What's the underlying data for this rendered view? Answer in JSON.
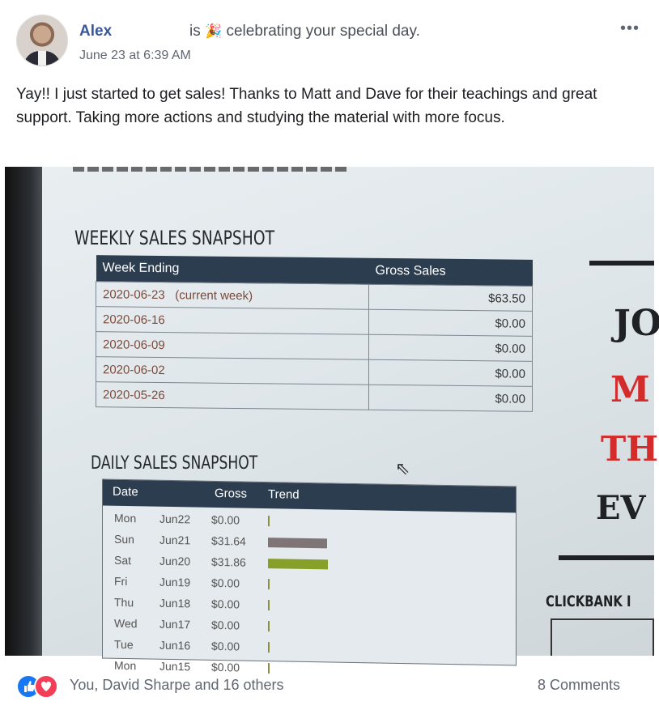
{
  "post": {
    "author": "Alex",
    "activity_prefix": "is",
    "activity_text": "celebrating your special day.",
    "timestamp": "June 23 at 6:39 AM",
    "more_icon": "•••",
    "text": "Yay!! I just started to get sales! Thanks to Matt and Dave for their teachings and great support. Taking more actions and studying the material with more focus."
  },
  "photo": {
    "weekly_title": "WEEKLY SALES SNAPSHOT",
    "weekly_headers": [
      "Week Ending",
      "Gross Sales"
    ],
    "weekly_rows": [
      {
        "date": "2020-06-23",
        "note": "(current week)",
        "amount": "$63.50"
      },
      {
        "date": "2020-06-16",
        "note": "",
        "amount": "$0.00"
      },
      {
        "date": "2020-06-09",
        "note": "",
        "amount": "$0.00"
      },
      {
        "date": "2020-06-02",
        "note": "",
        "amount": "$0.00"
      },
      {
        "date": "2020-05-26",
        "note": "",
        "amount": "$0.00"
      }
    ],
    "daily_title": "DAILY SALES SNAPSHOT",
    "daily_headers": [
      "Date",
      "Gross",
      "Trend"
    ],
    "daily_rows": [
      {
        "day": "Mon",
        "date": "Jun22",
        "gross": "$0.00",
        "trend": 0
      },
      {
        "day": "Sun",
        "date": "Jun21",
        "gross": "$31.64",
        "trend": 31.64
      },
      {
        "day": "Sat",
        "date": "Jun20",
        "gross": "$31.86",
        "trend": 31.86
      },
      {
        "day": "Fri",
        "date": "Jun19",
        "gross": "$0.00",
        "trend": 0
      },
      {
        "day": "Thu",
        "date": "Jun18",
        "gross": "$0.00",
        "trend": 0
      },
      {
        "day": "Wed",
        "date": "Jun17",
        "gross": "$0.00",
        "trend": 0
      },
      {
        "day": "Tue",
        "date": "Jun16",
        "gross": "$0.00",
        "trend": 0
      },
      {
        "day": "Mon",
        "date": "Jun15",
        "gross": "$0.00",
        "trend": 0
      }
    ],
    "side_texts": [
      "JO",
      "M",
      "TH",
      "EV",
      "CLICKBANK I"
    ],
    "colors": {
      "header": "#2b3d4f",
      "sun_bar": "#7f7577",
      "sat_bar": "#86a02a",
      "red_text": "#d42b2b"
    }
  },
  "footer": {
    "reactions": [
      "like-icon",
      "love-icon"
    ],
    "reactors": "You, David Sharpe and 16 others",
    "comments": "8 Comments"
  }
}
